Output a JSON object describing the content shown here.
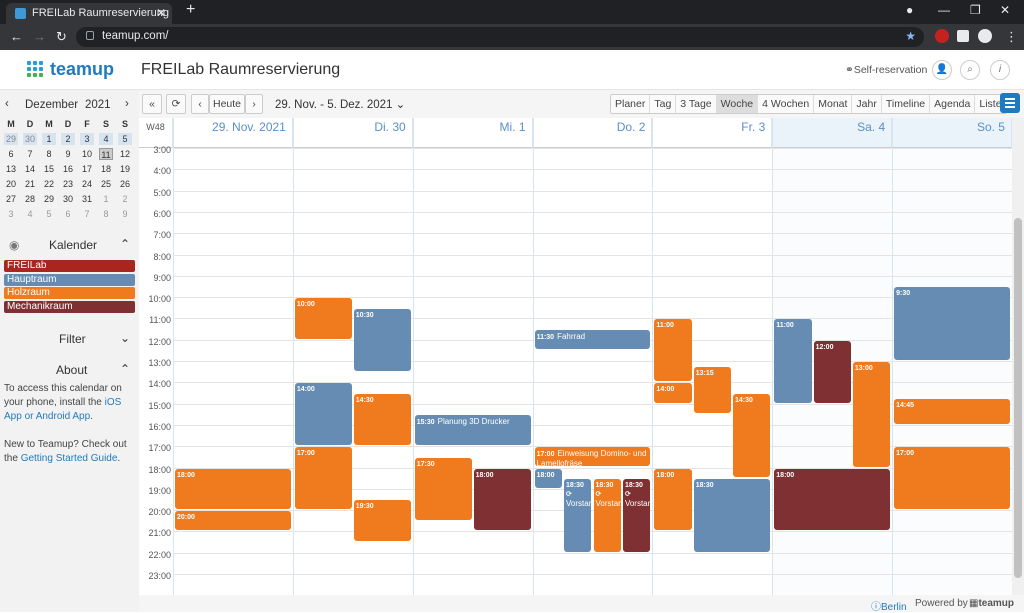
{
  "browser": {
    "tab_title": "FREILab Raumreservierung | Team",
    "url": "teamup.com/"
  },
  "app": {
    "logo": "teamup",
    "title": "FREILab Raumreservierung",
    "self_reservation": "Self-reservation"
  },
  "minical": {
    "month": "Dezember",
    "year": "2021",
    "weekdays": [
      "M",
      "D",
      "M",
      "D",
      "F",
      "S",
      "S"
    ],
    "weeks": [
      [
        "29",
        "30",
        "1",
        "2",
        "3",
        "4",
        "5"
      ],
      [
        "6",
        "7",
        "8",
        "9",
        "10",
        "11",
        "12"
      ],
      [
        "13",
        "14",
        "15",
        "16",
        "17",
        "18",
        "19"
      ],
      [
        "20",
        "21",
        "22",
        "23",
        "24",
        "25",
        "26"
      ],
      [
        "27",
        "28",
        "29",
        "30",
        "31",
        "1",
        "2"
      ],
      [
        "3",
        "4",
        "5",
        "6",
        "7",
        "8",
        "9"
      ]
    ]
  },
  "sidebar": {
    "kalender_label": "Kalender",
    "calendars": [
      {
        "name": "FREILab",
        "color": "#a8261d"
      },
      {
        "name": "Hauptraum",
        "color": "#668cb3"
      },
      {
        "name": "Holzraum",
        "color": "#f07a1e"
      },
      {
        "name": "Mechanikraum",
        "color": "#7e3033"
      }
    ],
    "filter_label": "Filter",
    "about_label": "About",
    "about_text1": "To access this calendar on your phone, install the ",
    "about_link1": "iOS App or Android App",
    "about_text1_end": ".",
    "about_text2": "New to Teamup? Check out the ",
    "about_link2": "Getting Started Guide",
    "about_text2_end": "."
  },
  "toolbar": {
    "today": "Heute",
    "range": "29. Nov. - 5. Dez. 2021",
    "views": [
      "Planer",
      "Tag",
      "3 Tage",
      "Woche",
      "4 Wochen",
      "Monat",
      "Jahr",
      "Timeline",
      "Agenda",
      "Liste"
    ],
    "active_view": "Woche"
  },
  "week": {
    "label": "W48",
    "days": [
      "29. Nov. 2021",
      "Di. 30",
      "Mi. 1",
      "Do. 2",
      "Fr. 3",
      "Sa. 4",
      "So. 5"
    ],
    "hours": [
      "3:00",
      "4:00",
      "5:00",
      "6:00",
      "7:00",
      "8:00",
      "9:00",
      "10:00",
      "11:00",
      "12:00",
      "13:00",
      "14:00",
      "15:00",
      "16:00",
      "17:00",
      "18:00",
      "19:00",
      "20:00",
      "21:00",
      "22:00",
      "23:00"
    ]
  },
  "events": [
    {
      "day": 0,
      "start": 18,
      "end": 20,
      "lane": 0,
      "lanes": 1,
      "time": "18:00",
      "title": "",
      "cal": 2
    },
    {
      "day": 0,
      "start": 20,
      "end": 21,
      "lane": 0,
      "lanes": 1,
      "time": "20:00",
      "title": "",
      "cal": 2
    },
    {
      "day": 1,
      "start": 10,
      "end": 12,
      "lane": 0,
      "lanes": 2,
      "time": "10:00",
      "title": "",
      "cal": 2
    },
    {
      "day": 1,
      "start": 10.5,
      "end": 13.5,
      "lane": 1,
      "lanes": 2,
      "time": "10:30",
      "title": "",
      "cal": 1
    },
    {
      "day": 1,
      "start": 14,
      "end": 17,
      "lane": 0,
      "lanes": 2,
      "time": "14:00",
      "title": "",
      "cal": 1
    },
    {
      "day": 1,
      "start": 14.5,
      "end": 17,
      "lane": 1,
      "lanes": 2,
      "time": "14:30",
      "title": "",
      "cal": 2
    },
    {
      "day": 1,
      "start": 17,
      "end": 20,
      "lane": 0,
      "lanes": 2,
      "time": "17:00",
      "title": "",
      "cal": 2
    },
    {
      "day": 1,
      "start": 19.5,
      "end": 21.5,
      "lane": 1,
      "lanes": 2,
      "time": "19:30",
      "title": "",
      "cal": 2
    },
    {
      "day": 2,
      "start": 15.5,
      "end": 17,
      "lane": 0,
      "lanes": 1,
      "time": "15:30",
      "title": "Planung 3D Drucker",
      "cal": 1
    },
    {
      "day": 2,
      "start": 17.5,
      "end": 20.5,
      "lane": 0,
      "lanes": 2,
      "time": "17:30",
      "title": "",
      "cal": 2
    },
    {
      "day": 2,
      "start": 18,
      "end": 21,
      "lane": 1,
      "lanes": 2,
      "time": "18:00",
      "title": "",
      "cal": 3
    },
    {
      "day": 3,
      "start": 11.5,
      "end": 12.5,
      "lane": 0,
      "lanes": 1,
      "time": "11:30",
      "title": "Fahrrad",
      "cal": 1
    },
    {
      "day": 3,
      "start": 17,
      "end": 18,
      "lane": 0,
      "lanes": 1,
      "time": "17:00",
      "title": "Einweisung Domino- und Lamellofräse",
      "cal": 2
    },
    {
      "day": 3,
      "start": 18,
      "end": 19,
      "lane": 0,
      "lanes": 4,
      "time": "18:00",
      "title": "",
      "cal": 1
    },
    {
      "day": 3,
      "start": 18.5,
      "end": 22,
      "lane": 1,
      "lanes": 4,
      "time": "18:30",
      "title": "Vorstandsabend",
      "cal": 1,
      "recur": true
    },
    {
      "day": 3,
      "start": 18.5,
      "end": 22,
      "lane": 2,
      "lanes": 4,
      "time": "18:30",
      "title": "Vorstandsabend",
      "cal": 2,
      "recur": true
    },
    {
      "day": 3,
      "start": 18.5,
      "end": 22,
      "lane": 3,
      "lanes": 4,
      "time": "18:30",
      "title": "Vorstandsabend",
      "cal": 3,
      "recur": true
    },
    {
      "day": 4,
      "start": 11,
      "end": 14,
      "lane": 0,
      "lanes": 3,
      "time": "11:00",
      "title": "",
      "cal": 2
    },
    {
      "day": 4,
      "start": 14,
      "end": 15,
      "lane": 0,
      "lanes": 3,
      "time": "14:00",
      "title": "",
      "cal": 2
    },
    {
      "day": 4,
      "start": 13.25,
      "end": 15.5,
      "lane": 1,
      "lanes": 3,
      "time": "13:15",
      "title": "",
      "cal": 2
    },
    {
      "day": 4,
      "start": 14.5,
      "end": 18.5,
      "lane": 2,
      "lanes": 3,
      "time": "14:30",
      "title": "",
      "cal": 2
    },
    {
      "day": 4,
      "start": 18,
      "end": 21,
      "lane": 0,
      "lanes": 3,
      "time": "18:00",
      "title": "",
      "cal": 2
    },
    {
      "day": 4,
      "start": 18.5,
      "end": 22,
      "lane": 1,
      "lanes": 3,
      "time": "18:30",
      "title": "",
      "cal": 1,
      "span": 2
    },
    {
      "day": 5,
      "start": 11,
      "end": 15,
      "lane": 0,
      "lanes": 3,
      "time": "11:00",
      "title": "",
      "cal": 1
    },
    {
      "day": 5,
      "start": 12,
      "end": 15,
      "lane": 1,
      "lanes": 3,
      "time": "12:00",
      "title": "",
      "cal": 3
    },
    {
      "day": 5,
      "start": 13,
      "end": 18,
      "lane": 2,
      "lanes": 3,
      "time": "13:00",
      "title": "",
      "cal": 2
    },
    {
      "day": 5,
      "start": 18,
      "end": 21,
      "lane": 0,
      "lanes": 1,
      "time": "18:00",
      "title": "",
      "cal": 3
    },
    {
      "day": 6,
      "start": 9.5,
      "end": 13,
      "lane": 0,
      "lanes": 1,
      "time": "9:30",
      "title": "",
      "cal": 1
    },
    {
      "day": 6,
      "start": 14.75,
      "end": 16,
      "lane": 0,
      "lanes": 1,
      "time": "14:45",
      "title": "",
      "cal": 2
    },
    {
      "day": 6,
      "start": 17,
      "end": 20,
      "lane": 0,
      "lanes": 1,
      "time": "17:00",
      "title": "",
      "cal": 2
    }
  ],
  "footer": {
    "timezone": "Berlin",
    "powered": "Powered by",
    "brand": "teamup"
  }
}
